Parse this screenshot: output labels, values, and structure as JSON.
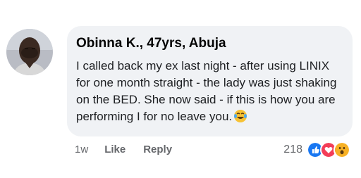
{
  "comment": {
    "author": "Obinna K., 47yrs, Abuja",
    "text": "I called back my ex last night - after using LINIX for one month straight - the lady was just shaking on the BED. She now said - if this is how you are performing I for no leave you.",
    "timestamp": "1w",
    "like_label": "Like",
    "reply_label": "Reply",
    "reaction_count": "218",
    "reactions": [
      "like-icon",
      "love-icon",
      "wow-icon"
    ]
  },
  "colors": {
    "bubble": "#f0f2f5",
    "like_blue": "#1877f2",
    "love_red": "#f33e58",
    "wow_yellow": "#f7b125",
    "meta_gray": "#65676b"
  }
}
